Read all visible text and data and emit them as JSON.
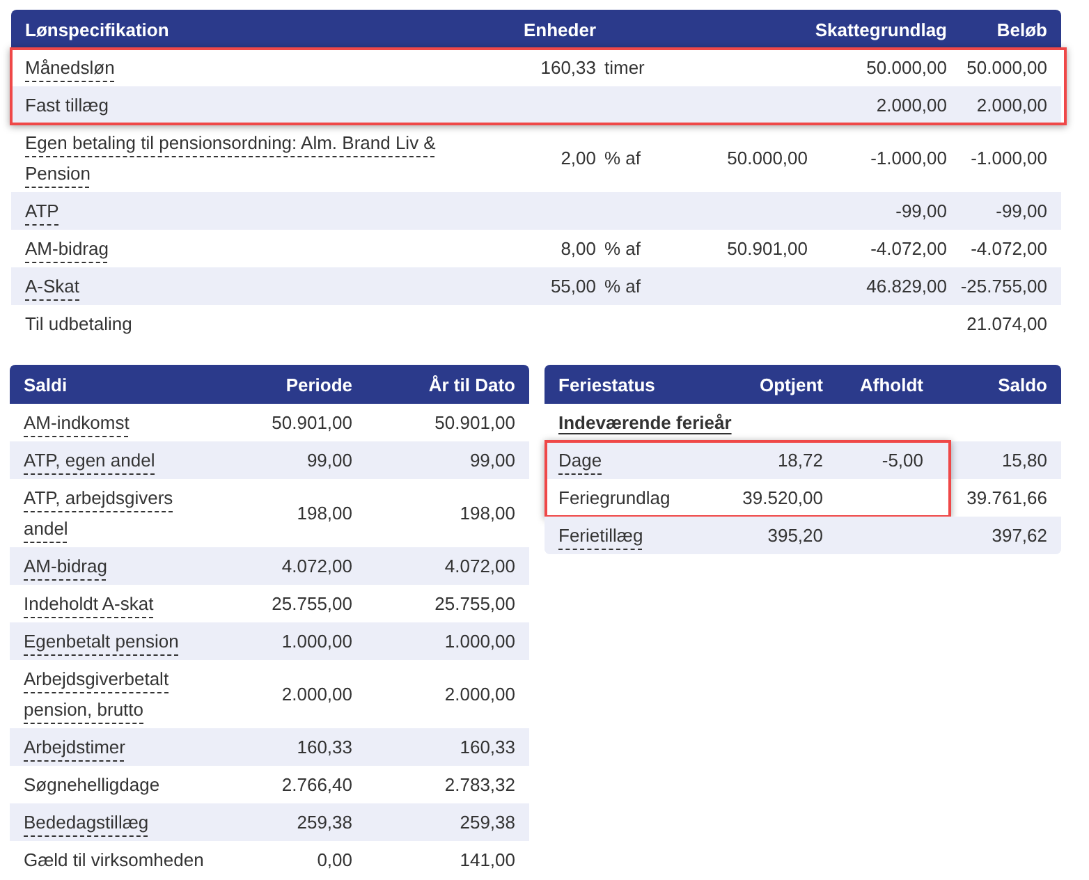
{
  "salary": {
    "columns": [
      {
        "label": "Lønspecifikation"
      },
      {
        "label": "Enheder"
      },
      {
        "label": "Skattegrundlag"
      },
      {
        "label": "Beløb"
      }
    ],
    "row_groups": [
      {
        "highlighted": true,
        "rows": [
          {
            "label": "Månedsløn",
            "underlined": true,
            "units": "160,33",
            "unit": "timer",
            "tax_base": "50.000,00",
            "amount": "50.000,00"
          },
          {
            "label": "Fast tillæg",
            "underlined": false,
            "tax_base": "2.000,00",
            "amount": "2.000,00"
          }
        ]
      },
      {
        "highlighted": false,
        "rows": [
          {
            "label": "Egen betaling til pensionsordning: Alm. Brand Liv & Pension",
            "underlined": true,
            "units": "2,00",
            "unit": "% af",
            "base": "50.000,00",
            "tax_base": "-1.000,00",
            "amount": "-1.000,00"
          },
          {
            "label": "ATP",
            "underlined": true,
            "tax_base": "-99,00",
            "amount": "-99,00"
          },
          {
            "label": "AM-bidrag",
            "underlined": true,
            "units": "8,00",
            "unit": "% af",
            "base": "50.901,00",
            "tax_base": "-4.072,00",
            "amount": "-4.072,00"
          },
          {
            "label": "A-Skat",
            "underlined": true,
            "units": "55,00",
            "unit": "% af",
            "tax_base": "46.829,00",
            "amount": "-25.755,00"
          },
          {
            "label": "Til udbetaling",
            "underlined": false,
            "amount": "21.074,00"
          }
        ]
      }
    ]
  },
  "balances": {
    "columns": [
      "Saldi",
      "Periode",
      "År til Dato"
    ],
    "rows": [
      {
        "label": "AM-indkomst",
        "underlined": true,
        "period": "50.901,00",
        "ytd": "50.901,00"
      },
      {
        "label": "ATP, egen andel",
        "underlined": true,
        "period": "99,00",
        "ytd": "99,00"
      },
      {
        "label": "ATP, arbejdsgivers andel",
        "underlined": true,
        "period": "198,00",
        "ytd": "198,00"
      },
      {
        "label": "AM-bidrag",
        "underlined": true,
        "period": "4.072,00",
        "ytd": "4.072,00"
      },
      {
        "label": "Indeholdt A-skat",
        "underlined": true,
        "period": "25.755,00",
        "ytd": "25.755,00"
      },
      {
        "label": "Egenbetalt pension",
        "underlined": true,
        "period": "1.000,00",
        "ytd": "1.000,00"
      },
      {
        "label": "Arbejdsgiverbetalt pension, brutto",
        "underlined": true,
        "period": "2.000,00",
        "ytd": "2.000,00"
      },
      {
        "label": "Arbejdstimer",
        "underlined": true,
        "period": "160,33",
        "ytd": "160,33"
      },
      {
        "label": "Søgnehelligdage",
        "underlined": false,
        "period": "2.766,40",
        "ytd": "2.783,32"
      },
      {
        "label": "Bededagstillæg",
        "underlined": true,
        "period": "259,38",
        "ytd": "259,38"
      },
      {
        "label": "Gæld til virksomheden",
        "underlined": false,
        "period": "0,00",
        "ytd": "141,00"
      }
    ]
  },
  "holiday": {
    "columns": [
      "Feriestatus",
      "Optjent",
      "Afholdt",
      "Saldo"
    ],
    "section": "Indeværende ferieår",
    "row_groups": [
      {
        "highlighted": true,
        "rows": [
          {
            "label": "Dage",
            "underlined": true,
            "earned": "18,72",
            "taken": "-5,00",
            "balance": "15,80"
          },
          {
            "label": "Feriegrundlag",
            "underlined": false,
            "earned": "39.520,00",
            "balance": "39.761,66"
          }
        ]
      },
      {
        "highlighted": false,
        "rows": [
          {
            "label": "Ferietillæg",
            "underlined": true,
            "earned": "395,20",
            "balance": "397,62"
          }
        ]
      }
    ]
  }
}
